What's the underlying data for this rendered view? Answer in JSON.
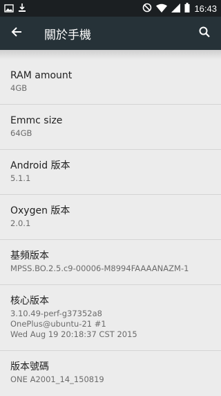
{
  "status_bar": {
    "time": "16:43",
    "icons": [
      "image-icon",
      "download-icon",
      "no-sim-icon",
      "wifi-icon",
      "signal-icon",
      "battery-icon"
    ]
  },
  "toolbar": {
    "title": "關於手機",
    "back_icon": "arrow-back-icon",
    "search_icon": "search-icon"
  },
  "items": [
    {
      "title": "RAM amount",
      "lines": [
        "4GB"
      ]
    },
    {
      "title": "Emmc size",
      "lines": [
        "64GB"
      ]
    },
    {
      "title": "Android 版本",
      "lines": [
        "5.1.1"
      ]
    },
    {
      "title": "Oxygen 版本",
      "lines": [
        "2.0.1"
      ]
    },
    {
      "title": "基頻版本",
      "lines": [
        "MPSS.BO.2.5.c9-00006-M8994FAAAANAZM-1"
      ]
    },
    {
      "title": "核心版本",
      "lines": [
        "3.10.49-perf-g37352a8",
        "OnePlus@ubuntu-21 #1",
        "Wed Aug 19 20:18:37 CST 2015"
      ]
    },
    {
      "title": "版本號碼",
      "lines": [
        "ONE A2001_14_150819"
      ]
    }
  ],
  "colors": {
    "status_bar": "#1b1f22",
    "toolbar": "#263238",
    "background": "#ececec",
    "divider": "#d4d4d4"
  }
}
